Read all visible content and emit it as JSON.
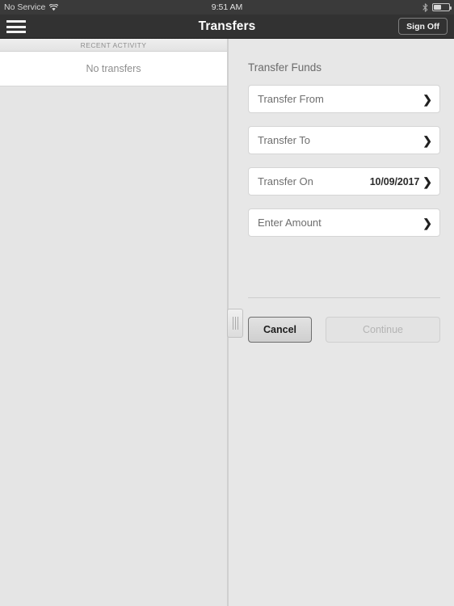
{
  "status_bar": {
    "carrier": "No Service",
    "wifi_icon": "wifi-icon",
    "time": "9:51 AM",
    "bluetooth_icon": "bluetooth-icon",
    "battery_icon": "battery-icon",
    "battery_level_percent": 45
  },
  "nav_bar": {
    "menu_icon": "hamburger-menu-icon",
    "title": "Transfers",
    "sign_off_label": "Sign Off"
  },
  "left_panel": {
    "section_header": "RECENT ACTIVITY",
    "empty_message": "No transfers"
  },
  "splitter": {
    "handle_icon": "drag-handle-icon"
  },
  "right_panel": {
    "title": "Transfer Funds",
    "fields": [
      {
        "label": "Transfer From",
        "value": "",
        "chevron": "chevron-right-icon"
      },
      {
        "label": "Transfer To",
        "value": "",
        "chevron": "chevron-right-icon"
      },
      {
        "label": "Transfer On",
        "value": "10/09/2017",
        "chevron": "chevron-right-icon"
      },
      {
        "label": "Enter Amount",
        "value": "",
        "chevron": "chevron-right-icon"
      }
    ],
    "buttons": {
      "cancel_label": "Cancel",
      "continue_label": "Continue",
      "continue_disabled": true
    }
  },
  "colors": {
    "nav_background": "#323232",
    "status_background": "#3a3a3a",
    "panel_background": "#e7e7e7",
    "field_background": "#ffffff",
    "field_border": "#d5d5d5",
    "label_text": "#6e6e6e",
    "value_text": "#2b2b2b",
    "disabled_text": "#b4b4b4"
  }
}
